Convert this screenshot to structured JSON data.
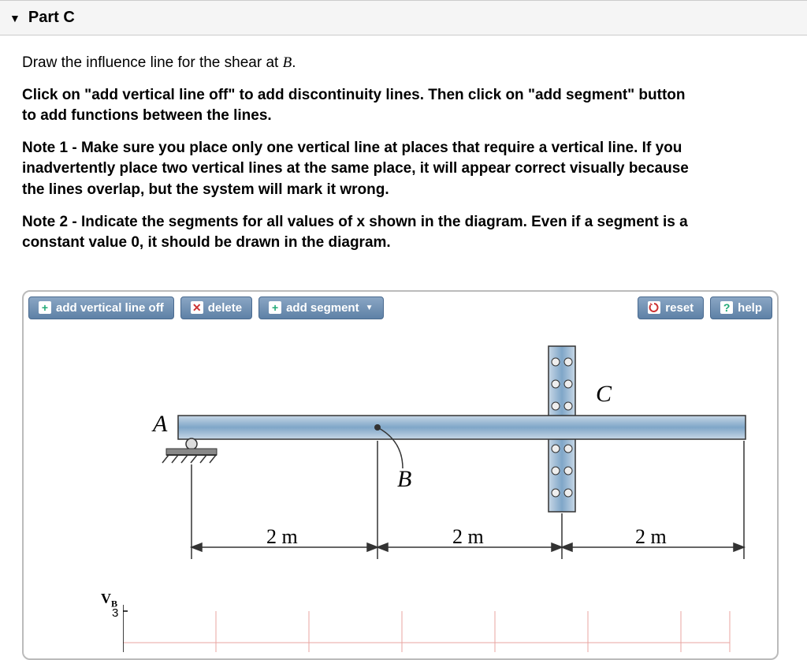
{
  "part": {
    "label": "Part C"
  },
  "question": {
    "line1_prefix": "Draw the influence line for the shear at ",
    "line1_point": "B",
    "line1_suffix": ".",
    "instr_main": "Click on \"add vertical line off\" to add discontinuity lines. Then click on \"add segment\" button to add functions between the lines.",
    "note1": "Note 1 - Make sure you place only one vertical line at places that require a vertical line. If you inadvertently place two vertical lines at the same place, it will appear correct visually because the lines overlap, but the system will mark it wrong.",
    "note2": "Note 2 - Indicate the segments for all values of x shown in the diagram. Even if a segment is a constant value 0, it should be drawn in the diagram."
  },
  "toolbar": {
    "add_vline": "add vertical line off",
    "delete": "delete",
    "add_segment": "add segment",
    "reset": "reset",
    "help": "help"
  },
  "diagram": {
    "labelA": "A",
    "labelB": "B",
    "labelC": "C",
    "dim1": "2 m",
    "dim2": "2 m",
    "dim3": "2 m"
  },
  "graph": {
    "y_axis_symbol": "V",
    "y_axis_sub": "B",
    "top_tick": "3"
  }
}
